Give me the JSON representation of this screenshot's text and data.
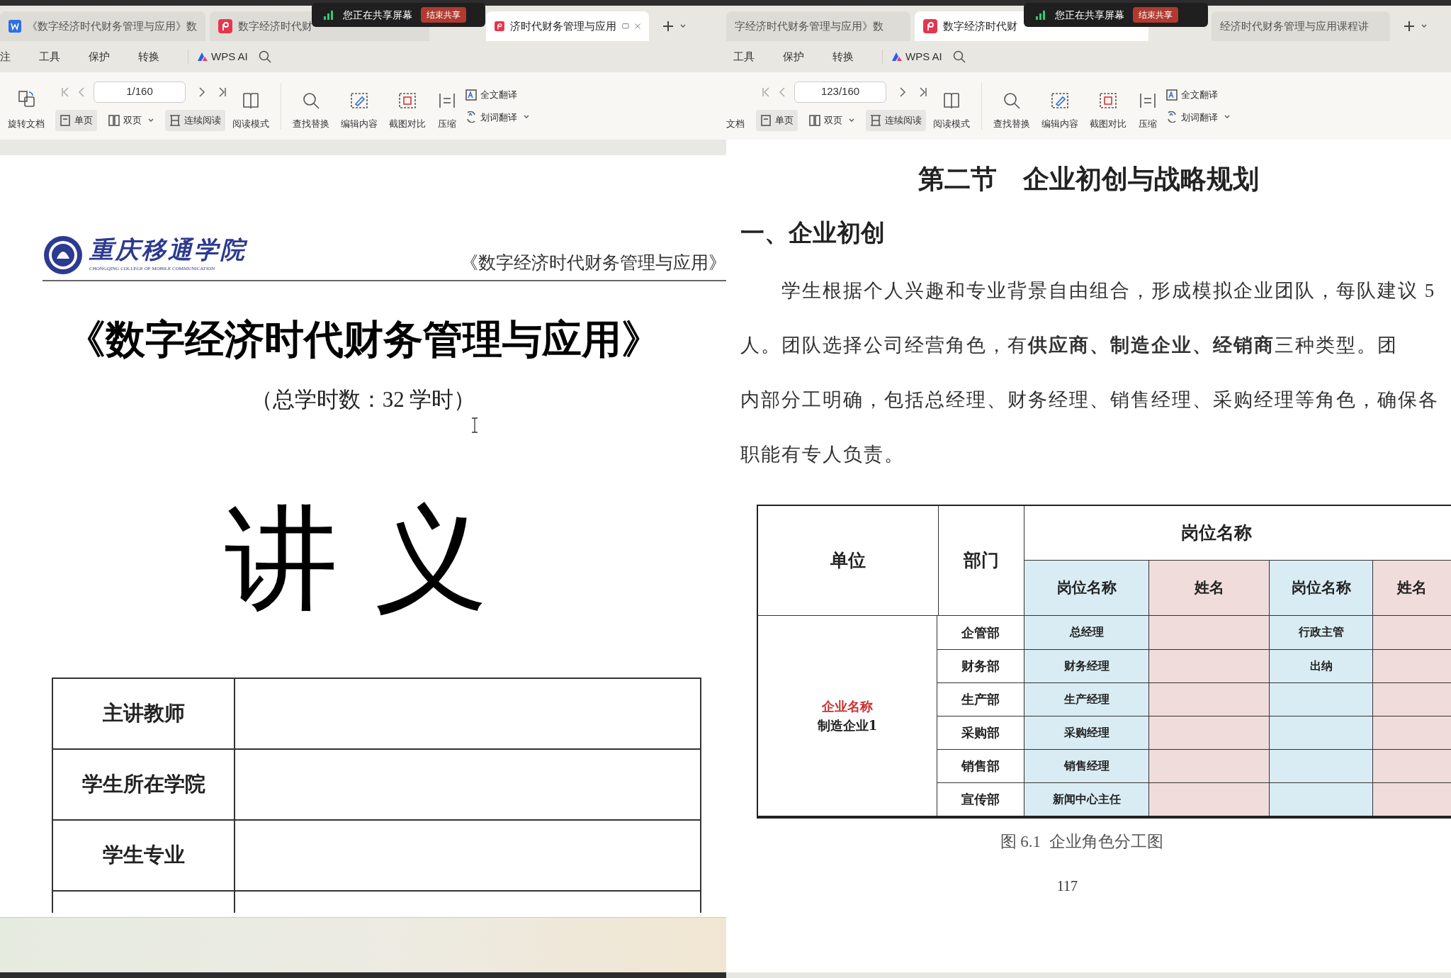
{
  "panes": [
    {
      "tabs": [
        {
          "label": "《数字经济时代财务管理与应用》数",
          "kind": "writer",
          "selected": false
        },
        {
          "label": "数字经济时代财",
          "kind": "pdf",
          "selected": false
        },
        {
          "label": "济时代财务管理与应用",
          "kind": "pdf",
          "selected": true
        }
      ],
      "share_banner": {
        "text": "您正在共享屏幕",
        "button": "结束共享"
      },
      "menu": [
        "注",
        "工具",
        "保护",
        "转换",
        "WPS AI"
      ],
      "toolbar": {
        "rotate": {
          "label": "旋转文档",
          "icon_visible": true
        },
        "page": "1/160",
        "view_modes": [
          {
            "label": "单页",
            "on": true,
            "dropdown": false
          },
          {
            "label": "双页",
            "on": false,
            "dropdown": true
          },
          {
            "label": "连续阅读",
            "on": true,
            "dropdown": false
          }
        ],
        "reading_mode": "阅读模式",
        "tools": [
          {
            "label": "查找替换",
            "kind": "search"
          },
          {
            "label": "编辑内容",
            "kind": "edit"
          },
          {
            "label": "截图对比",
            "kind": "compare"
          },
          {
            "label": "压缩",
            "kind": "compress"
          }
        ],
        "translate": [
          {
            "label": "全文翻译",
            "dropdown": false
          },
          {
            "label": "划词翻译",
            "dropdown": true
          }
        ]
      },
      "document": {
        "kind": "cover",
        "logo": {
          "name": "重庆移通学院",
          "subtitle": "CHONGQING COLLEGE OF MOBILE COMMUNICATION"
        },
        "header": "《数字经济时代财务管理与应用》",
        "title": "《数字经济时代财务管理与应用》",
        "hours": "（总学时数：32 学时）",
        "heading": "讲 义",
        "form_rows": [
          "主讲教师",
          "学生所在学院",
          "学生专业"
        ],
        "more_rows_below": true
      }
    },
    {
      "tabs": [
        {
          "label": "字经济时代财务管理与应用》数",
          "kind": "plain",
          "selected": false
        },
        {
          "label": "数字经济时代财",
          "kind": "pdf",
          "selected": true
        },
        {
          "label": "经济时代财务管理与应用课程讲",
          "kind": "plain",
          "selected": false
        }
      ],
      "share_banner": {
        "text": "您正在共享屏幕",
        "button": "结束共享"
      },
      "menu": [
        "工具",
        "保护",
        "转换",
        "WPS AI"
      ],
      "toolbar": {
        "rotate": {
          "label": "文档",
          "icon_visible": false
        },
        "page": "123/160",
        "view_modes": [
          {
            "label": "单页",
            "on": true,
            "dropdown": false
          },
          {
            "label": "双页",
            "on": false,
            "dropdown": true
          },
          {
            "label": "连续阅读",
            "on": true,
            "dropdown": false
          }
        ],
        "reading_mode": "阅读模式",
        "tools": [
          {
            "label": "查找替换",
            "kind": "search"
          },
          {
            "label": "编辑内容",
            "kind": "edit"
          },
          {
            "label": "截图对比",
            "kind": "compare"
          },
          {
            "label": "压缩",
            "kind": "compress"
          }
        ],
        "translate": [
          {
            "label": "全文翻译",
            "dropdown": false
          },
          {
            "label": "划词翻译",
            "dropdown": true
          }
        ]
      },
      "document": {
        "kind": "chapter",
        "section_title": "第二节　企业初创与战略规划",
        "subheading": "一、企业初创",
        "paragraph_lines": [
          "学生根据个人兴趣和专业背景自由组合，形成模拟企业团队，每队建议 5",
          "人。团队选择公司经营角色，有**供应商、制造企业、经销商**三种类型。团",
          "内部分工明确，包括总经理、财务经理、销售经理、采购经理等角色，确保各",
          "职能有专人负责。"
        ],
        "table": {
          "unit_header": "单位",
          "dept_header": "部门",
          "group_header": "岗位名称",
          "sub_headers": [
            {
              "label": "岗位名称",
              "kind": "position"
            },
            {
              "label": "姓名",
              "kind": "name"
            },
            {
              "label": "岗位名称",
              "kind": "position"
            },
            {
              "label": "姓名",
              "kind": "name"
            }
          ],
          "unit": {
            "label": "企业名称",
            "name": "制造企业1"
          },
          "rows": [
            {
              "dept": "企管部",
              "position_1": "总经理",
              "position_2": "行政主管"
            },
            {
              "dept": "财务部",
              "position_1": "财务经理",
              "position_2": "出纳"
            },
            {
              "dept": "生产部",
              "position_1": "生产经理"
            },
            {
              "dept": "采购部",
              "position_1": "采购经理"
            },
            {
              "dept": "销售部",
              "position_1": "销售经理"
            },
            {
              "dept": "宣传部",
              "position_1": "新闻中心主任"
            }
          ]
        },
        "caption": "图 6.1  企业角色分工图",
        "page_number": "117"
      }
    }
  ]
}
